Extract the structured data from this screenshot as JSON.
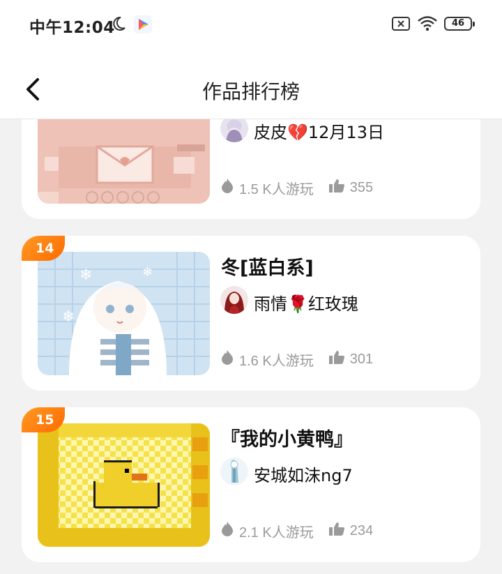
{
  "status_bar": {
    "time": "中午12:04",
    "battery": "46",
    "icons": [
      "moon-icon",
      "app-icon",
      "sim-off-icon",
      "wifi-icon",
      "battery-icon"
    ]
  },
  "header": {
    "title": "作品排行榜",
    "back_icon": "chevron-left-icon"
  },
  "items": [
    {
      "rank": "",
      "title": "",
      "author": "皮皮💔12月13日",
      "plays": "1.5 K人游玩",
      "likes": "355"
    },
    {
      "rank": "14",
      "title": "冬[蓝白系]",
      "author": "雨情🌹红玫瑰",
      "plays": "1.6 K人游玩",
      "likes": "301"
    },
    {
      "rank": "15",
      "title": "『我的小黄鸭』",
      "author": "安城如沫ng7",
      "plays": "2.1 K人游玩",
      "likes": "234"
    }
  ],
  "colors": {
    "rank_badge": "#ff7a0f",
    "stat_text": "#9a9a9a",
    "background": "#f2f2f2"
  }
}
